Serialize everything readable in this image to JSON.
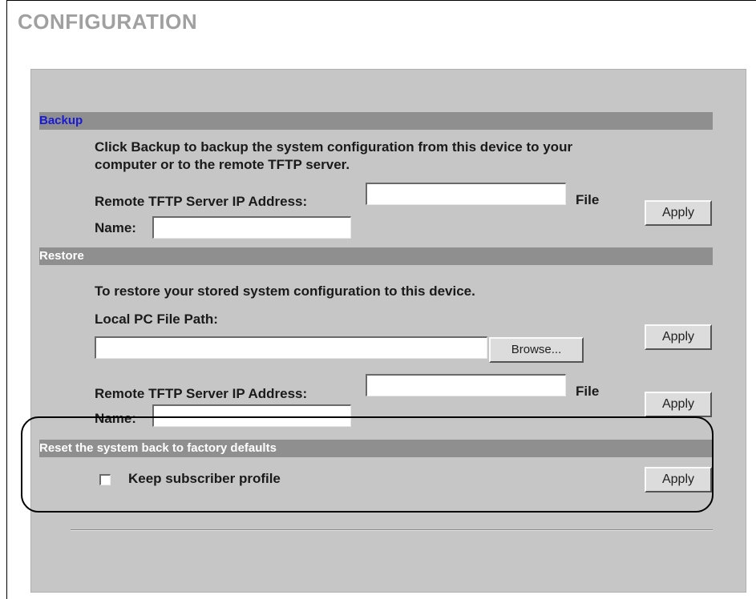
{
  "page": {
    "title": "CONFIGURATION"
  },
  "backup": {
    "header": "Backup",
    "description_line1": "Click Backup to backup the system configuration from this device to your",
    "description_line2": "computer or to the remote TFTP server.",
    "tftp_label": "Remote TFTP Server IP Address:",
    "file_label": "File",
    "name_label": "Name:",
    "tftp_value": "",
    "name_value": "",
    "apply_label": "Apply"
  },
  "restore": {
    "header": "Restore",
    "description": "To restore your stored system configuration to this device.",
    "local_path_label": "Local PC File Path:",
    "local_path_value": "",
    "browse_label": "Browse...",
    "apply_label": "Apply",
    "tftp_label": "Remote TFTP Server IP Address:",
    "file_label": "File",
    "name_label": "Name:",
    "tftp_value": "",
    "name_value": "",
    "tftp_apply_label": "Apply"
  },
  "reset": {
    "header": "Reset the system back to factory defaults",
    "keep_profile_label": "Keep subscriber profile",
    "keep_profile_checked": false,
    "apply_label": "Apply"
  }
}
